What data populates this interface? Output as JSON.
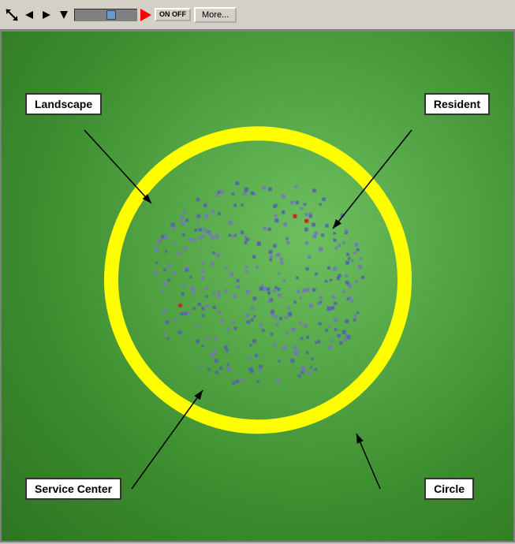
{
  "toolbar": {
    "more_label": "More...",
    "onoff_label": "ON\nOFF"
  },
  "labels": {
    "landscape": "Landscape",
    "resident": "Resident",
    "service_center": "Service Center",
    "circle": "Circle"
  },
  "visualization": {
    "circle_color": "#ffff00",
    "bg_color": "#4a9940",
    "dot_color_blue": "#6666aa",
    "dot_color_red": "#cc3333",
    "dot_count": 300
  }
}
